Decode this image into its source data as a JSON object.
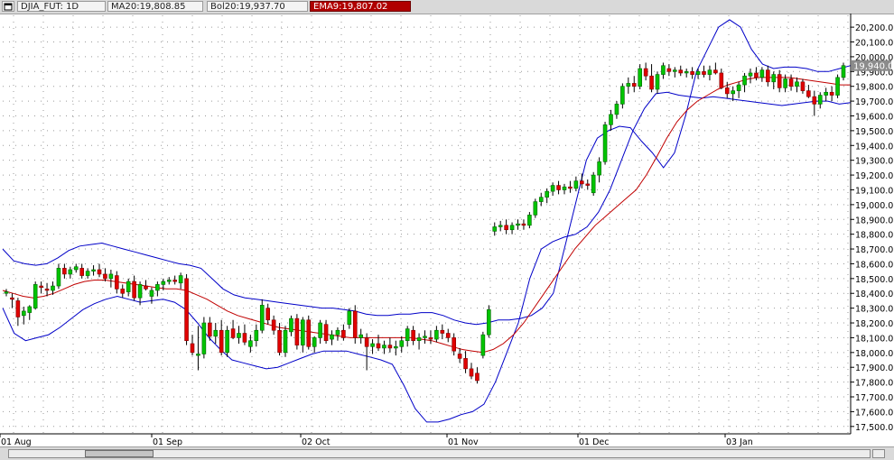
{
  "header": {
    "menu_icon": "window-menu-icon",
    "symbol_label": "DJIA_FUT: 1D",
    "ma_label": "MA20:19,808.85",
    "bol_label": "Bol20:19,937.70",
    "ema_label": "EMA9:19,807.02"
  },
  "colors": {
    "up_candle": "#00c400",
    "down_candle": "#e00000",
    "wick": "#000000",
    "bollinger": "#0000c8",
    "ma": "#c00000",
    "grid": "#9a9a9a",
    "ema_tab": "#b00000"
  },
  "chart_data": {
    "type": "candlestick",
    "title": "",
    "xlabel": "",
    "ylabel": "",
    "ylim": [
      17450,
      20280
    ],
    "grid": true,
    "y_ticks": [
      "20,200.0",
      "20,100.0",
      "20,000.0",
      "19,900.0",
      "19,800.0",
      "19,700.0",
      "19,600.0",
      "19,500.0",
      "19,400.0",
      "19,300.0",
      "19,200.0",
      "19,100.0",
      "19,000.0",
      "18,900.0",
      "18,800.0",
      "18,700.0",
      "18,600.0",
      "18,500.0",
      "18,400.0",
      "18,300.0",
      "18,200.0",
      "18,100.0",
      "18,000.0",
      "17,900.0",
      "17,800.0",
      "17,700.0",
      "17,600.0",
      "17,500.0"
    ],
    "x_labels": [
      "01 Aug",
      "01 Sep",
      "02 Oct",
      "01 Nov",
      "01 Dec",
      "03 Jan"
    ],
    "last_price_label": "19,940.0",
    "last_price": 19940,
    "candles": [
      {
        "o": 18400,
        "h": 18430,
        "l": 18380,
        "c": 18410
      },
      {
        "o": 18370,
        "h": 18400,
        "l": 18300,
        "c": 18360
      },
      {
        "o": 18350,
        "h": 18370,
        "l": 18180,
        "c": 18240
      },
      {
        "o": 18250,
        "h": 18310,
        "l": 18190,
        "c": 18280
      },
      {
        "o": 18270,
        "h": 18320,
        "l": 18220,
        "c": 18310
      },
      {
        "o": 18300,
        "h": 18480,
        "l": 18290,
        "c": 18460
      },
      {
        "o": 18450,
        "h": 18480,
        "l": 18400,
        "c": 18440
      },
      {
        "o": 18430,
        "h": 18470,
        "l": 18380,
        "c": 18420
      },
      {
        "o": 18420,
        "h": 18480,
        "l": 18390,
        "c": 18450
      },
      {
        "o": 18450,
        "h": 18600,
        "l": 18430,
        "c": 18570
      },
      {
        "o": 18570,
        "h": 18600,
        "l": 18500,
        "c": 18530
      },
      {
        "o": 18530,
        "h": 18580,
        "l": 18500,
        "c": 18560
      },
      {
        "o": 18560,
        "h": 18600,
        "l": 18540,
        "c": 18580
      },
      {
        "o": 18570,
        "h": 18600,
        "l": 18500,
        "c": 18520
      },
      {
        "o": 18520,
        "h": 18570,
        "l": 18500,
        "c": 18550
      },
      {
        "o": 18550,
        "h": 18590,
        "l": 18520,
        "c": 18560
      },
      {
        "o": 18560,
        "h": 18600,
        "l": 18510,
        "c": 18530
      },
      {
        "o": 18530,
        "h": 18570,
        "l": 18480,
        "c": 18500
      },
      {
        "o": 18500,
        "h": 18560,
        "l": 18440,
        "c": 18530
      },
      {
        "o": 18520,
        "h": 18550,
        "l": 18400,
        "c": 18430
      },
      {
        "o": 18430,
        "h": 18460,
        "l": 18370,
        "c": 18400
      },
      {
        "o": 18410,
        "h": 18500,
        "l": 18380,
        "c": 18480
      },
      {
        "o": 18480,
        "h": 18520,
        "l": 18350,
        "c": 18370
      },
      {
        "o": 18370,
        "h": 18480,
        "l": 18320,
        "c": 18460
      },
      {
        "o": 18450,
        "h": 18490,
        "l": 18420,
        "c": 18430
      },
      {
        "o": 18380,
        "h": 18440,
        "l": 18330,
        "c": 18420
      },
      {
        "o": 18420,
        "h": 18480,
        "l": 18380,
        "c": 18460
      },
      {
        "o": 18460,
        "h": 18500,
        "l": 18420,
        "c": 18480
      },
      {
        "o": 18480,
        "h": 18510,
        "l": 18460,
        "c": 18490
      },
      {
        "o": 18490,
        "h": 18520,
        "l": 18460,
        "c": 18480
      },
      {
        "o": 18470,
        "h": 18540,
        "l": 18430,
        "c": 18520
      },
      {
        "o": 18500,
        "h": 18530,
        "l": 18050,
        "c": 18080
      },
      {
        "o": 18060,
        "h": 18120,
        "l": 17980,
        "c": 18000
      },
      {
        "o": 17980,
        "h": 18180,
        "l": 17880,
        "c": 17990
      },
      {
        "o": 17990,
        "h": 18240,
        "l": 17960,
        "c": 18200
      },
      {
        "o": 18200,
        "h": 18240,
        "l": 18080,
        "c": 18110
      },
      {
        "o": 18110,
        "h": 18200,
        "l": 18060,
        "c": 18150
      },
      {
        "o": 18150,
        "h": 18220,
        "l": 17980,
        "c": 18000
      },
      {
        "o": 18000,
        "h": 18180,
        "l": 17970,
        "c": 18150
      },
      {
        "o": 18160,
        "h": 18220,
        "l": 18090,
        "c": 18100
      },
      {
        "o": 18100,
        "h": 18180,
        "l": 18060,
        "c": 18130
      },
      {
        "o": 18130,
        "h": 18190,
        "l": 18050,
        "c": 18070
      },
      {
        "o": 18040,
        "h": 18120,
        "l": 18000,
        "c": 18080
      },
      {
        "o": 18080,
        "h": 18190,
        "l": 18040,
        "c": 18150
      },
      {
        "o": 18150,
        "h": 18360,
        "l": 18130,
        "c": 18320
      },
      {
        "o": 18300,
        "h": 18330,
        "l": 18190,
        "c": 18220
      },
      {
        "o": 18220,
        "h": 18250,
        "l": 18120,
        "c": 18150
      },
      {
        "o": 18150,
        "h": 18200,
        "l": 17980,
        "c": 18000
      },
      {
        "o": 18000,
        "h": 18180,
        "l": 17970,
        "c": 18150
      },
      {
        "o": 18140,
        "h": 18250,
        "l": 18110,
        "c": 18230
      },
      {
        "o": 18230,
        "h": 18260,
        "l": 18020,
        "c": 18050
      },
      {
        "o": 18050,
        "h": 18240,
        "l": 18000,
        "c": 18220
      },
      {
        "o": 18220,
        "h": 18250,
        "l": 18020,
        "c": 18040
      },
      {
        "o": 18040,
        "h": 18110,
        "l": 18000,
        "c": 18100
      },
      {
        "o": 18100,
        "h": 18220,
        "l": 18060,
        "c": 18200
      },
      {
        "o": 18190,
        "h": 18220,
        "l": 18060,
        "c": 18080
      },
      {
        "o": 18090,
        "h": 18150,
        "l": 18050,
        "c": 18120
      },
      {
        "o": 18120,
        "h": 18170,
        "l": 18080,
        "c": 18150
      },
      {
        "o": 18150,
        "h": 18190,
        "l": 18080,
        "c": 18100
      },
      {
        "o": 18190,
        "h": 18300,
        "l": 18160,
        "c": 18280
      },
      {
        "o": 18280,
        "h": 18320,
        "l": 18060,
        "c": 18100
      },
      {
        "o": 18100,
        "h": 18160,
        "l": 18060,
        "c": 18120
      },
      {
        "o": 18100,
        "h": 18130,
        "l": 17880,
        "c": 18040
      },
      {
        "o": 18040,
        "h": 18090,
        "l": 17990,
        "c": 18060
      },
      {
        "o": 18060,
        "h": 18120,
        "l": 18010,
        "c": 18030
      },
      {
        "o": 18030,
        "h": 18080,
        "l": 17990,
        "c": 18050
      },
      {
        "o": 18050,
        "h": 18100,
        "l": 18000,
        "c": 18030
      },
      {
        "o": 18030,
        "h": 18080,
        "l": 17980,
        "c": 18040
      },
      {
        "o": 18040,
        "h": 18110,
        "l": 18000,
        "c": 18080
      },
      {
        "o": 18080,
        "h": 18180,
        "l": 18040,
        "c": 18160
      },
      {
        "o": 18150,
        "h": 18180,
        "l": 18050,
        "c": 18080
      },
      {
        "o": 18080,
        "h": 18130,
        "l": 18020,
        "c": 18100
      },
      {
        "o": 18100,
        "h": 18150,
        "l": 18060,
        "c": 18110
      },
      {
        "o": 18100,
        "h": 18150,
        "l": 18060,
        "c": 18090
      },
      {
        "o": 18090,
        "h": 18180,
        "l": 18070,
        "c": 18150
      },
      {
        "o": 18150,
        "h": 18190,
        "l": 18090,
        "c": 18130
      },
      {
        "o": 18130,
        "h": 18160,
        "l": 18070,
        "c": 18100
      },
      {
        "o": 18100,
        "h": 18130,
        "l": 17980,
        "c": 18010
      },
      {
        "o": 17990,
        "h": 18030,
        "l": 17930,
        "c": 17960
      },
      {
        "o": 17960,
        "h": 18010,
        "l": 17860,
        "c": 17890
      },
      {
        "o": 17890,
        "h": 17930,
        "l": 17820,
        "c": 17840
      },
      {
        "o": 17860,
        "h": 17900,
        "l": 17790,
        "c": 17810
      },
      {
        "o": 17980,
        "h": 18140,
        "l": 17960,
        "c": 18120
      },
      {
        "o": 18120,
        "h": 18320,
        "l": 18100,
        "c": 18290
      },
      {
        "o": 18820,
        "h": 18880,
        "l": 18790,
        "c": 18850
      },
      {
        "o": 18850,
        "h": 18890,
        "l": 18820,
        "c": 18860
      },
      {
        "o": 18860,
        "h": 18900,
        "l": 18800,
        "c": 18830
      },
      {
        "o": 18830,
        "h": 18880,
        "l": 18800,
        "c": 18860
      },
      {
        "o": 18860,
        "h": 18900,
        "l": 18830,
        "c": 18870
      },
      {
        "o": 18870,
        "h": 18900,
        "l": 18830,
        "c": 18860
      },
      {
        "o": 18860,
        "h": 18950,
        "l": 18840,
        "c": 18930
      },
      {
        "o": 18930,
        "h": 19040,
        "l": 18910,
        "c": 19020
      },
      {
        "o": 19020,
        "h": 19080,
        "l": 18990,
        "c": 19050
      },
      {
        "o": 19050,
        "h": 19110,
        "l": 19010,
        "c": 19090
      },
      {
        "o": 19090,
        "h": 19150,
        "l": 19060,
        "c": 19130
      },
      {
        "o": 19130,
        "h": 19160,
        "l": 19070,
        "c": 19100
      },
      {
        "o": 19100,
        "h": 19140,
        "l": 19070,
        "c": 19120
      },
      {
        "o": 19120,
        "h": 19160,
        "l": 19080,
        "c": 19110
      },
      {
        "o": 19110,
        "h": 19190,
        "l": 19090,
        "c": 19160
      },
      {
        "o": 19160,
        "h": 19210,
        "l": 19110,
        "c": 19140
      },
      {
        "o": 19140,
        "h": 19170,
        "l": 19100,
        "c": 19130
      },
      {
        "o": 19080,
        "h": 19220,
        "l": 19060,
        "c": 19200
      },
      {
        "o": 19200,
        "h": 19320,
        "l": 19150,
        "c": 19290
      },
      {
        "o": 19290,
        "h": 19560,
        "l": 19270,
        "c": 19540
      },
      {
        "o": 19540,
        "h": 19640,
        "l": 19500,
        "c": 19610
      },
      {
        "o": 19610,
        "h": 19700,
        "l": 19580,
        "c": 19680
      },
      {
        "o": 19680,
        "h": 19820,
        "l": 19650,
        "c": 19800
      },
      {
        "o": 19800,
        "h": 19860,
        "l": 19750,
        "c": 19820
      },
      {
        "o": 19820,
        "h": 19870,
        "l": 19760,
        "c": 19800
      },
      {
        "o": 19800,
        "h": 19950,
        "l": 19780,
        "c": 19920
      },
      {
        "o": 19920,
        "h": 19960,
        "l": 19840,
        "c": 19870
      },
      {
        "o": 19870,
        "h": 19950,
        "l": 19760,
        "c": 19780
      },
      {
        "o": 19780,
        "h": 19900,
        "l": 19750,
        "c": 19880
      },
      {
        "o": 19880,
        "h": 19960,
        "l": 19850,
        "c": 19940
      },
      {
        "o": 19920,
        "h": 19950,
        "l": 19870,
        "c": 19900
      },
      {
        "o": 19900,
        "h": 19930,
        "l": 19860,
        "c": 19910
      },
      {
        "o": 19910,
        "h": 19940,
        "l": 19870,
        "c": 19890
      },
      {
        "o": 19890,
        "h": 19920,
        "l": 19860,
        "c": 19900
      },
      {
        "o": 19900,
        "h": 19930,
        "l": 19850,
        "c": 19880
      },
      {
        "o": 19880,
        "h": 19920,
        "l": 19850,
        "c": 19900
      },
      {
        "o": 19900,
        "h": 19940,
        "l": 19860,
        "c": 19880
      },
      {
        "o": 19880,
        "h": 19940,
        "l": 19840,
        "c": 19910
      },
      {
        "o": 19910,
        "h": 19960,
        "l": 19880,
        "c": 19890
      },
      {
        "o": 19890,
        "h": 19920,
        "l": 19780,
        "c": 19790
      },
      {
        "o": 19790,
        "h": 19830,
        "l": 19720,
        "c": 19750
      },
      {
        "o": 19750,
        "h": 19800,
        "l": 19700,
        "c": 19770
      },
      {
        "o": 19770,
        "h": 19830,
        "l": 19720,
        "c": 19810
      },
      {
        "o": 19810,
        "h": 19890,
        "l": 19760,
        "c": 19870
      },
      {
        "o": 19870,
        "h": 19920,
        "l": 19820,
        "c": 19890
      },
      {
        "o": 19890,
        "h": 19930,
        "l": 19840,
        "c": 19860
      },
      {
        "o": 19860,
        "h": 19930,
        "l": 19830,
        "c": 19910
      },
      {
        "o": 19910,
        "h": 19940,
        "l": 19800,
        "c": 19830
      },
      {
        "o": 19830,
        "h": 19900,
        "l": 19780,
        "c": 19880
      },
      {
        "o": 19880,
        "h": 19910,
        "l": 19760,
        "c": 19790
      },
      {
        "o": 19790,
        "h": 19880,
        "l": 19760,
        "c": 19850
      },
      {
        "o": 19850,
        "h": 19880,
        "l": 19770,
        "c": 19800
      },
      {
        "o": 19800,
        "h": 19860,
        "l": 19760,
        "c": 19830
      },
      {
        "o": 19830,
        "h": 19850,
        "l": 19750,
        "c": 19770
      },
      {
        "o": 19770,
        "h": 19810,
        "l": 19720,
        "c": 19730
      },
      {
        "o": 19730,
        "h": 19770,
        "l": 19600,
        "c": 19680
      },
      {
        "o": 19680,
        "h": 19760,
        "l": 19650,
        "c": 19740
      },
      {
        "o": 19740,
        "h": 19790,
        "l": 19700,
        "c": 19760
      },
      {
        "o": 19760,
        "h": 19800,
        "l": 19700,
        "c": 19740
      },
      {
        "o": 19740,
        "h": 19880,
        "l": 19720,
        "c": 19860
      },
      {
        "o": 19860,
        "h": 19960,
        "l": 19840,
        "c": 19940
      }
    ],
    "bollinger_upper": [
      18700,
      18620,
      18600,
      18590,
      18600,
      18640,
      18690,
      18720,
      18730,
      18740,
      18720,
      18700,
      18680,
      18660,
      18640,
      18620,
      18600,
      18590,
      18570,
      18500,
      18430,
      18390,
      18370,
      18360,
      18350,
      18340,
      18330,
      18320,
      18310,
      18300,
      18300,
      18290,
      18280,
      18260,
      18250,
      18250,
      18260,
      18260,
      18270,
      18270,
      18250,
      18220,
      18200,
      18190,
      18200,
      18220,
      18220,
      18230,
      18250,
      18300,
      18400,
      18700,
      19000,
      19300,
      19450,
      19500,
      19530,
      19520,
      19430,
      19350,
      19250,
      19350,
      19600,
      19900,
      20050,
      20200,
      20250,
      20200,
      20050,
      19950,
      19920,
      19930,
      19930,
      19920,
      19900,
      19900,
      19920,
      19940
    ],
    "bollinger_lower": [
      18300,
      18130,
      18080,
      18100,
      18120,
      18170,
      18230,
      18290,
      18330,
      18360,
      18380,
      18360,
      18340,
      18350,
      18360,
      18340,
      18290,
      18200,
      18100,
      18020,
      17950,
      17930,
      17910,
      17890,
      17900,
      17930,
      17960,
      17990,
      18010,
      18010,
      18010,
      17990,
      17970,
      17950,
      17920,
      17780,
      17620,
      17530,
      17530,
      17550,
      17580,
      17600,
      17650,
      17800,
      18000,
      18200,
      18500,
      18700,
      18750,
      18780,
      18800,
      18850,
      18950,
      19100,
      19300,
      19500,
      19650,
      19750,
      19760,
      19740,
      19730,
      19720,
      19730,
      19720,
      19710,
      19700,
      19690,
      19680,
      19670,
      19680,
      19690,
      19700,
      19700,
      19680,
      19690
    ],
    "ma20": [
      18420,
      18400,
      18380,
      18370,
      18380,
      18400,
      18430,
      18460,
      18480,
      18490,
      18490,
      18480,
      18470,
      18460,
      18450,
      18440,
      18430,
      18430,
      18420,
      18390,
      18360,
      18320,
      18280,
      18250,
      18230,
      18210,
      18190,
      18170,
      18160,
      18150,
      18140,
      18130,
      18120,
      18110,
      18100,
      18100,
      18100,
      18100,
      18100,
      18100,
      18100,
      18090,
      18080,
      18060,
      18040,
      18020,
      18010,
      18000,
      18020,
      18060,
      18120,
      18200,
      18300,
      18400,
      18500,
      18600,
      18700,
      18780,
      18860,
      18920,
      18980,
      19040,
      19100,
      19200,
      19320,
      19450,
      19560,
      19640,
      19700,
      19740,
      19780,
      19810,
      19830,
      19850,
      19860,
      19860,
      19860,
      19860,
      19850,
      19840,
      19830,
      19820,
      19810,
      19810
    ]
  },
  "scrollbar": {
    "thumb_fraction": 0.08
  }
}
